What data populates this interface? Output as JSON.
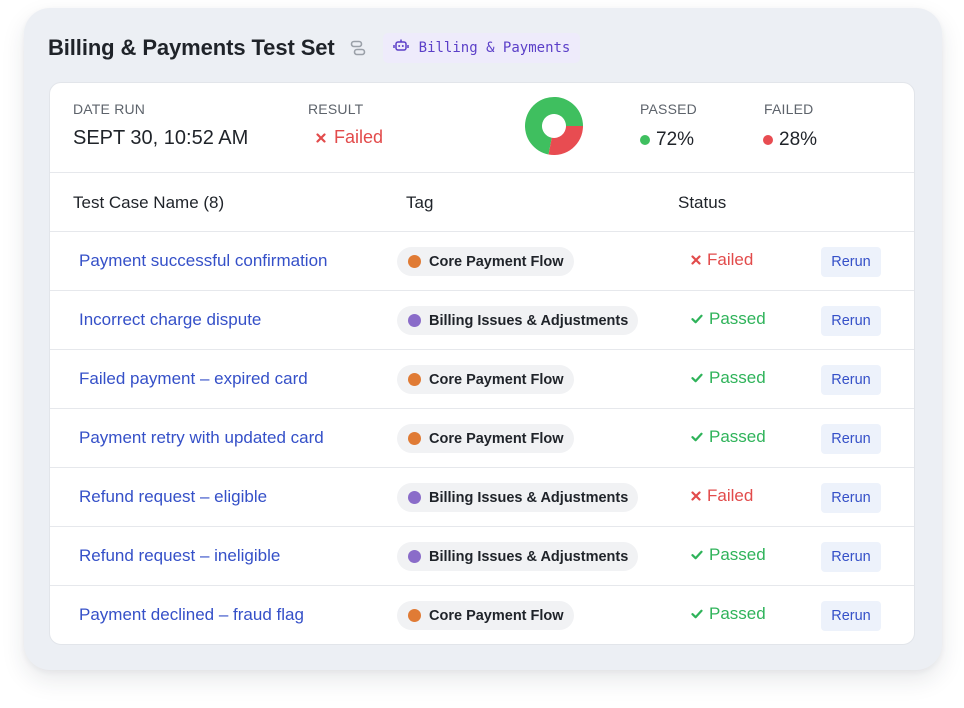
{
  "header": {
    "title": "Billing & Payments Test Set",
    "chip_label": "Billing & Payments"
  },
  "summary": {
    "date_label": "DATE RUN",
    "date_value": "SEPT 30, 10:52 AM",
    "result_label": "RESULT",
    "result_value": "Failed",
    "passed_label": "PASSED",
    "passed_value": "72%",
    "failed_label": "FAILED",
    "failed_value": "28%",
    "passed_fraction": 0.72,
    "failed_fraction": 0.28
  },
  "colors": {
    "passed": "#3fbf5f",
    "failed": "#e84c51",
    "link": "#3550c8",
    "tag_core": "#e07b35",
    "tag_billing": "#8a6cc9"
  },
  "table": {
    "headers": [
      "Test Case Name (8)",
      "Tag",
      "Status"
    ],
    "rows": [
      {
        "name": "Payment successful confirmation",
        "tag": "Core Payment Flow",
        "tag_color": "#e07b35",
        "status": "Failed",
        "action": "Rerun"
      },
      {
        "name": "Incorrect charge dispute",
        "tag": "Billing Issues & Adjustments",
        "tag_color": "#8a6cc9",
        "status": "Passed",
        "action": "Rerun"
      },
      {
        "name": "Failed payment – expired card",
        "tag": "Core Payment Flow",
        "tag_color": "#e07b35",
        "status": "Passed",
        "action": "Rerun"
      },
      {
        "name": "Payment retry with updated card",
        "tag": "Core Payment Flow",
        "tag_color": "#e07b35",
        "status": "Passed",
        "action": "Rerun"
      },
      {
        "name": "Refund request – eligible",
        "tag": "Billing Issues & Adjustments",
        "tag_color": "#8a6cc9",
        "status": "Failed",
        "action": "Rerun"
      },
      {
        "name": "Refund request – ineligible",
        "tag": "Billing Issues & Adjustments",
        "tag_color": "#8a6cc9",
        "status": "Passed",
        "action": "Rerun"
      },
      {
        "name": "Payment declined – fraud flag",
        "tag": "Core Payment Flow",
        "tag_color": "#e07b35",
        "status": "Passed",
        "action": "Rerun"
      }
    ]
  },
  "icons": {
    "title_icon": "flow-icon",
    "chip_icon": "bot-icon",
    "failed_icon": "x-icon",
    "passed_icon": "check-icon"
  }
}
